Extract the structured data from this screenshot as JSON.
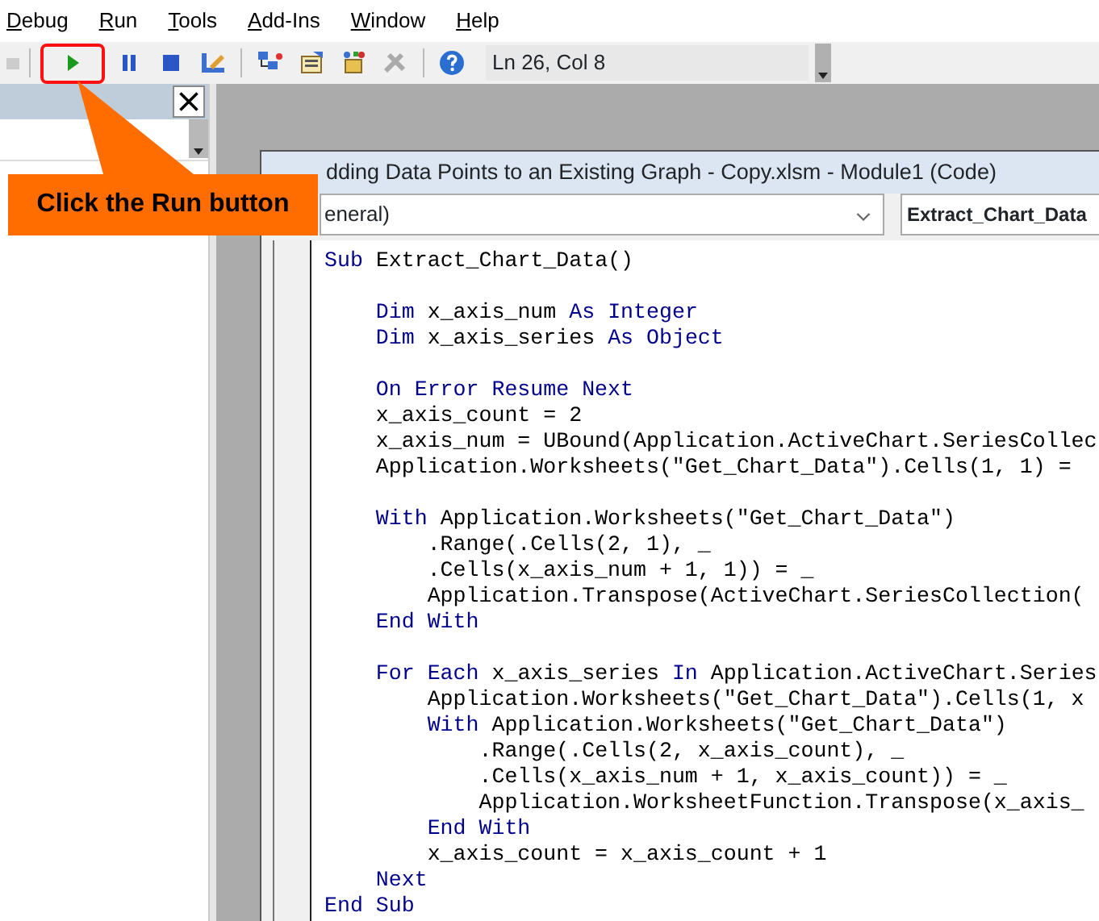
{
  "menu": [
    {
      "label": "Debug"
    },
    {
      "label": "Run"
    },
    {
      "label": "Tools"
    },
    {
      "label": "Add-Ins"
    },
    {
      "label": "Window"
    },
    {
      "label": "Help"
    }
  ],
  "toolbar": {
    "buttons": [
      {
        "kind": "run",
        "highlighted": true
      },
      {
        "kind": "pause",
        "highlighted": false
      },
      {
        "kind": "stop",
        "highlighted": false
      },
      {
        "kind": "design",
        "highlighted": false
      },
      {
        "kind": "sep"
      },
      {
        "kind": "project",
        "highlighted": false
      },
      {
        "kind": "properties",
        "highlighted": false
      },
      {
        "kind": "browser",
        "highlighted": false
      },
      {
        "kind": "toolbox",
        "highlighted": false
      },
      {
        "kind": "sep"
      },
      {
        "kind": "help",
        "highlighted": false
      }
    ],
    "position": "Ln 26, Col 8"
  },
  "callout": {
    "text": "Click the Run button"
  },
  "code_window": {
    "title": "dding Data Points to an Existing Graph - Copy.xlsm - Module1 (Code)",
    "object_combo": "eneral)",
    "procedure_combo": "Extract_Chart_Data",
    "lines": [
      {
        "kind": "code",
        "tokens": [
          {
            "kind": "keyword",
            "text": "Sub"
          },
          {
            "kind": "plain",
            "text": "Extract_Chart_Data()"
          }
        ],
        "children": [
          {
            "kind": "blank"
          },
          {
            "kind": "code",
            "tokens": [
              {
                "kind": "keyword",
                "text": "Dim"
              },
              {
                "kind": "plain",
                "text": "x_axis_num"
              },
              {
                "kind": "keyword",
                "text": "As Integer"
              }
            ]
          },
          {
            "kind": "code",
            "tokens": [
              {
                "kind": "keyword",
                "text": "Dim"
              },
              {
                "kind": "plain",
                "text": "x_axis_series"
              },
              {
                "kind": "keyword",
                "text": "As Object"
              }
            ]
          },
          {
            "kind": "blank"
          },
          {
            "kind": "code",
            "tokens": [
              {
                "kind": "keyword",
                "text": "On Error Resume Next"
              }
            ]
          },
          {
            "kind": "code",
            "tokens": [
              {
                "kind": "plain",
                "text": "x_axis_count = 2"
              }
            ]
          },
          {
            "kind": "code",
            "tokens": [
              {
                "kind": "plain",
                "text": "x_axis_num = UBound(Application.ActiveChart.SeriesCollec"
              }
            ]
          },
          {
            "kind": "code",
            "tokens": [
              {
                "kind": "plain",
                "text": "Application.Worksheets(\"Get_Chart_Data\").Cells(1, 1) ="
              }
            ]
          },
          {
            "kind": "blank"
          },
          {
            "kind": "code",
            "tokens": [
              {
                "kind": "keyword",
                "text": "With"
              },
              {
                "kind": "plain",
                "text": "Application.Worksheets(\"Get_Chart_Data\")"
              }
            ],
            "children": [
              {
                "kind": "code",
                "tokens": [
                  {
                    "kind": "plain",
                    "text": ".Range(.Cells(2, 1), _"
                  }
                ]
              },
              {
                "kind": "code",
                "tokens": [
                  {
                    "kind": "plain",
                    "text": ".Cells(x_axis_num + 1, 1)) = _"
                  }
                ]
              },
              {
                "kind": "code",
                "tokens": [
                  {
                    "kind": "plain",
                    "text": "Application.Transpose(ActiveChart.SeriesCollection("
                  }
                ]
              }
            ]
          },
          {
            "kind": "code",
            "tokens": [
              {
                "kind": "keyword",
                "text": "End With"
              }
            ]
          },
          {
            "kind": "blank"
          },
          {
            "kind": "code",
            "tokens": [
              {
                "kind": "keyword",
                "text": "For Each"
              },
              {
                "kind": "plain",
                "text": "x_axis_series"
              },
              {
                "kind": "keyword",
                "text": "In"
              },
              {
                "kind": "plain",
                "text": "Application.ActiveChart.Series"
              }
            ],
            "children": [
              {
                "kind": "code",
                "tokens": [
                  {
                    "kind": "plain",
                    "text": "Application.Worksheets(\"Get_Chart_Data\").Cells(1, x"
                  }
                ]
              },
              {
                "kind": "code",
                "tokens": [
                  {
                    "kind": "keyword",
                    "text": "With"
                  },
                  {
                    "kind": "plain",
                    "text": "Application.Worksheets(\"Get_Chart_Data\")"
                  }
                ],
                "children": [
                  {
                    "kind": "code",
                    "tokens": [
                      {
                        "kind": "plain",
                        "text": ".Range(.Cells(2, x_axis_count), _"
                      }
                    ]
                  },
                  {
                    "kind": "code",
                    "tokens": [
                      {
                        "kind": "plain",
                        "text": ".Cells(x_axis_num + 1, x_axis_count)) = _"
                      }
                    ]
                  },
                  {
                    "kind": "code",
                    "tokens": [
                      {
                        "kind": "plain",
                        "text": "Application.WorksheetFunction.Transpose(x_axis_"
                      }
                    ]
                  }
                ]
              },
              {
                "kind": "code",
                "tokens": [
                  {
                    "kind": "keyword",
                    "text": "End With"
                  }
                ]
              },
              {
                "kind": "code",
                "tokens": [
                  {
                    "kind": "plain",
                    "text": "x_axis_count = x_axis_count + 1"
                  }
                ]
              }
            ]
          },
          {
            "kind": "code",
            "tokens": [
              {
                "kind": "keyword",
                "text": "Next"
              }
            ]
          }
        ]
      },
      {
        "kind": "code",
        "tokens": [
          {
            "kind": "keyword",
            "text": "End Sub"
          }
        ]
      }
    ]
  }
}
